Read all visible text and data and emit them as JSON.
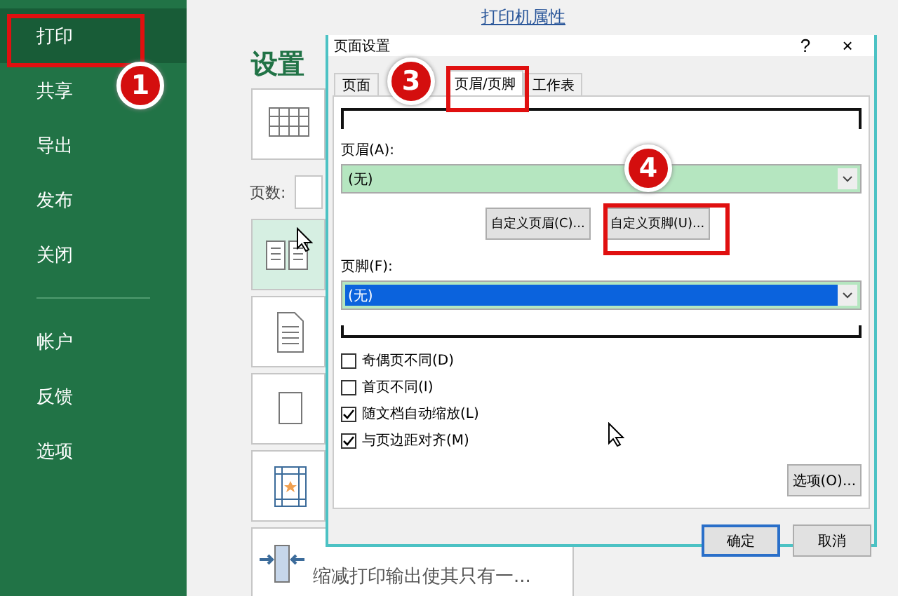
{
  "sidebar": {
    "items": [
      {
        "label": "打印",
        "selected": true
      },
      {
        "label": "共享",
        "selected": false
      },
      {
        "label": "导出",
        "selected": false
      },
      {
        "label": "发布",
        "selected": false
      },
      {
        "label": "关闭",
        "selected": false
      },
      {
        "label": "帐户",
        "selected": false,
        "kind": "after_divider"
      },
      {
        "label": "反馈",
        "selected": false
      },
      {
        "label": "选项",
        "selected": false
      }
    ]
  },
  "printer_properties_link": "打印机属性",
  "settings": {
    "title": "设置",
    "pages_label": "页数:",
    "tiles": [
      {
        "kind": "grid",
        "selected": false
      },
      {
        "kind": "collate",
        "selected": true
      },
      {
        "kind": "document",
        "selected": false
      },
      {
        "kind": "page",
        "selected": false
      },
      {
        "kind": "margins",
        "selected": false
      }
    ],
    "scaling": {
      "label": "缩减打印输出使其只有一..."
    }
  },
  "dialog": {
    "title": "页面设置",
    "help": "?",
    "close": "×",
    "tabs": [
      {
        "label": "页面",
        "selected": false
      },
      {
        "label": "页眉/页脚",
        "selected": true
      },
      {
        "label": "工作表",
        "selected": false
      }
    ],
    "header_label": "页眉(A):",
    "header_field": {
      "value": "(无)",
      "highlighted": false
    },
    "buttons_custom": [
      "自定义页眉(C)...",
      "自定义页脚(U)..."
    ],
    "footer_label": "页脚(F):",
    "footer_field": {
      "value": "(无)",
      "highlighted": true
    },
    "checkboxes": [
      {
        "label": "奇偶页不同(D)",
        "checked": false
      },
      {
        "label": "首页不同(I)",
        "checked": false
      },
      {
        "label": "随文档自动缩放(L)",
        "checked": true
      },
      {
        "label": "与页边距对齐(M)",
        "checked": true
      }
    ],
    "options_button": "选项(O)...",
    "ok": "确定",
    "cancel": "取消"
  },
  "markers": [
    {
      "number": "1"
    },
    {
      "number": "3"
    },
    {
      "number": "4"
    }
  ]
}
